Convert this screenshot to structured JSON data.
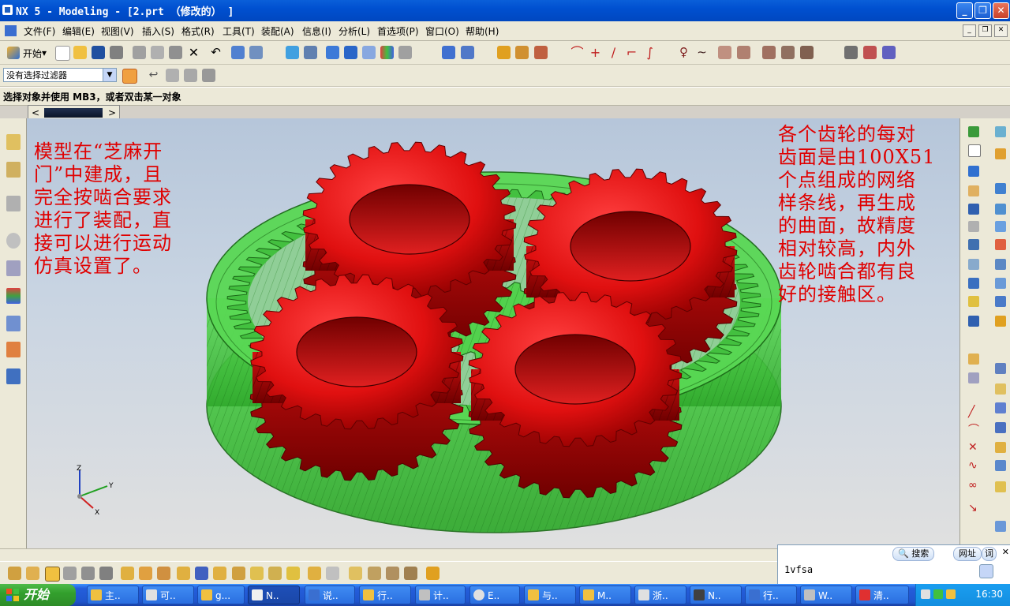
{
  "window": {
    "title": "NX 5 - Modeling - [2.prt （修改的） ]"
  },
  "menu": [
    "文件(F)",
    "编辑(E)",
    "视图(V)",
    "插入(S)",
    "格式(R)",
    "工具(T)",
    "装配(A)",
    "信息(I)",
    "分析(L)",
    "首选项(P)",
    "窗口(O)",
    "帮助(H)"
  ],
  "toolbar": {
    "start_label": "开始"
  },
  "filter": {
    "value": "没有选择过滤器"
  },
  "status": {
    "prompt": "选择对象并使用 MB3，或者双击某一对象"
  },
  "notes": {
    "left": "模型在“芝麻开\n门”中建成，且\n完全按啮合要求\n进行了装配，直\n接可以进行运动\n仿真设置了。",
    "right": "各个齿轮的每对\n齿面是由100X51\n个点组成的网络\n样条线，再生成\n的曲面，故精度\n相对较高，内外\n齿轮啮合都有良\n好的接触区。"
  },
  "triad": {
    "z": "Z",
    "y": "Y",
    "x": "X"
  },
  "search_panel": {
    "search_label": "搜索",
    "url_label": "网址",
    "word_label": "词",
    "input_text": "1vfsa"
  },
  "taskbar": {
    "start_label": "开始",
    "items": [
      "主..",
      "可..",
      "g...",
      "N..",
      "说..",
      "行..",
      "计..",
      "E..",
      "与..",
      "M..",
      "浙..",
      "N..",
      "行..",
      "W..",
      "清.."
    ],
    "clock": "16:30"
  },
  "colors": {
    "gear_red": "#e01010",
    "ring_green": "#3fcf3a",
    "note_red": "#e00000"
  }
}
